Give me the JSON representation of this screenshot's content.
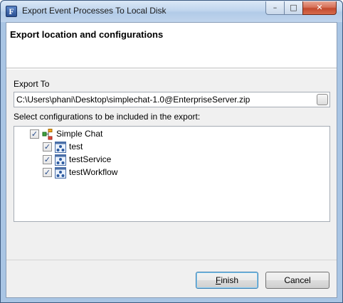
{
  "window": {
    "title": "Export Event Processes To Local Disk",
    "icon_letter": "F",
    "controls": {
      "minimize": "–",
      "maximize": "□",
      "close": "✕"
    }
  },
  "banner": {
    "title": "Export location and configurations"
  },
  "export_to": {
    "label": "Export To",
    "path": "C:\\Users\\phani\\Desktop\\simplechat-1.0@EnterpriseServer.zip"
  },
  "configurations": {
    "label": "Select configurations to be included in the export:",
    "tree": {
      "root": {
        "label": "Simple Chat",
        "checked": true,
        "icon": "project-icon"
      },
      "children": [
        {
          "label": "test",
          "checked": true,
          "icon": "config-icon"
        },
        {
          "label": "testService",
          "checked": true,
          "icon": "config-icon"
        },
        {
          "label": "testWorkflow",
          "checked": true,
          "icon": "config-icon"
        }
      ]
    }
  },
  "buttons": {
    "finish_mnemonic": "F",
    "finish_rest": "inish",
    "cancel": "Cancel"
  },
  "colors": {
    "title_bar": "#c1d6ee",
    "close_button": "#c24a2e",
    "dialog_bg": "#f0f0f0",
    "checkmark": "#2b4e8c"
  }
}
